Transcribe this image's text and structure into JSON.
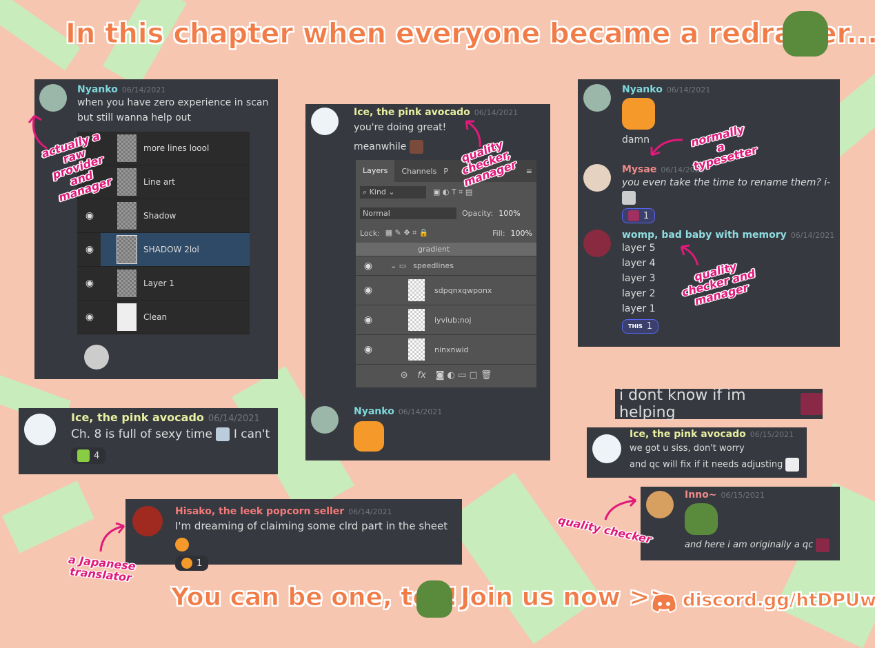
{
  "header": {
    "title": "In this chapter when everyone became a redrawer..."
  },
  "footer": {
    "left": "You can be one, too!",
    "middle": "Join us now >>",
    "link": "discord.gg/htDPUwf"
  },
  "colors": {
    "background": "#f6c6b0",
    "accent": "#f17c48",
    "annotation": "#e0197a",
    "panel": "#36393f"
  },
  "panel1": {
    "author": "Nyanko",
    "date": "06/14/2021",
    "lines": [
      "when you have zero experience in scan",
      "but still wanna help out"
    ],
    "layers": [
      {
        "name": "more lines loool",
        "visible": false
      },
      {
        "name": "Line art",
        "visible": false
      },
      {
        "name": "Shadow",
        "visible": true
      },
      {
        "name": "SHADOW 2lol",
        "visible": true,
        "selected": true
      },
      {
        "name": "Layer 1",
        "visible": true
      },
      {
        "name": "Clean",
        "visible": true
      }
    ],
    "note": "actually a raw provider and manager"
  },
  "panel2": {
    "author": "Ice, the pink avocado",
    "date": "06/14/2021",
    "lines": [
      "you're doing great!",
      "meanwhile"
    ],
    "ps": {
      "tabs": [
        "Layers",
        "Channels",
        "P"
      ],
      "kind": "Kind",
      "blend": "Normal",
      "opacity_label": "Opacity:",
      "opacity": "100%",
      "lock_label": "Lock:",
      "fill_label": "Fill:",
      "fill": "100%",
      "partial_layer": "gradient",
      "group": "speedlines",
      "layers": [
        "sdpqnxqwponx",
        "iyviub;noj",
        "ninxnwid"
      ]
    },
    "note": "quality checker, manager",
    "reply": {
      "author": "Nyanko",
      "date": "06/14/2021"
    }
  },
  "panel3": {
    "msg1": {
      "author": "Nyanko",
      "date": "06/14/2021",
      "text": "damn"
    },
    "note1": "normally a typesetter",
    "msg2": {
      "author": "Mysae",
      "date": "06/14/2021",
      "text": "you even take the time to rename them? i-",
      "reaction_count": "1"
    },
    "msg3": {
      "author": "womp, bad baby with memory",
      "date": "06/14/2021",
      "lines": [
        "layer 5",
        "layer 4",
        "layer 3",
        "layer 2",
        "layer 1"
      ],
      "reaction_count": "1",
      "reaction_label": "THIS"
    },
    "note2": "quality checker and manager"
  },
  "panel4": {
    "author": "Ice, the pink avocado",
    "date": "06/14/2021",
    "text": "Ch. 8 is full of sexy time",
    "text2": "I can't",
    "reaction_count": "4"
  },
  "panel5": {
    "author": "Hisako, the leek popcorn seller",
    "date": "06/14/2021",
    "text": "I'm dreaming of claiming some clrd part in the sheet",
    "reaction_count": "1",
    "note": "a Japanese translator"
  },
  "panel6": {
    "text": "i dont know if im helping"
  },
  "panel7": {
    "author": "Ice, the pink avocado",
    "date": "06/15/2021",
    "lines": [
      "we got u siss, don't worry",
      "and qc will fix if it needs adjusting"
    ]
  },
  "panel8": {
    "author": "Inno~",
    "date": "06/15/2021",
    "text": "and here i am originally a qc",
    "note": "quality checker"
  }
}
